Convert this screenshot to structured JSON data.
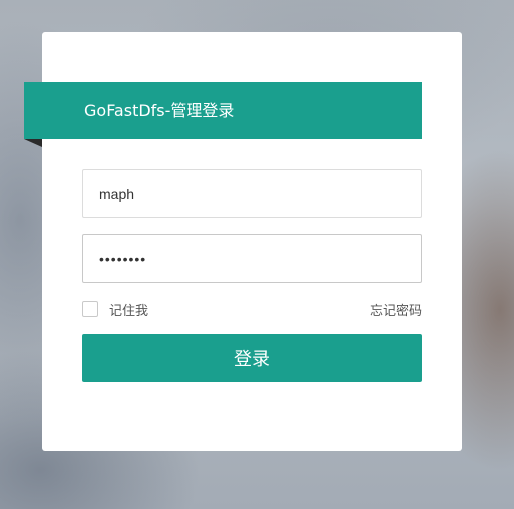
{
  "login": {
    "title": "GoFastDfs-管理登录",
    "username_value": "maph",
    "password_mask": "••••••••",
    "remember_label": "记住我",
    "remember_checked": false,
    "forgot_label": "忘记密码",
    "submit_label": "登录"
  },
  "colors": {
    "accent": "#1a9f8e",
    "ribbon_fold": "#2b2b2b",
    "card": "#ffffff"
  }
}
